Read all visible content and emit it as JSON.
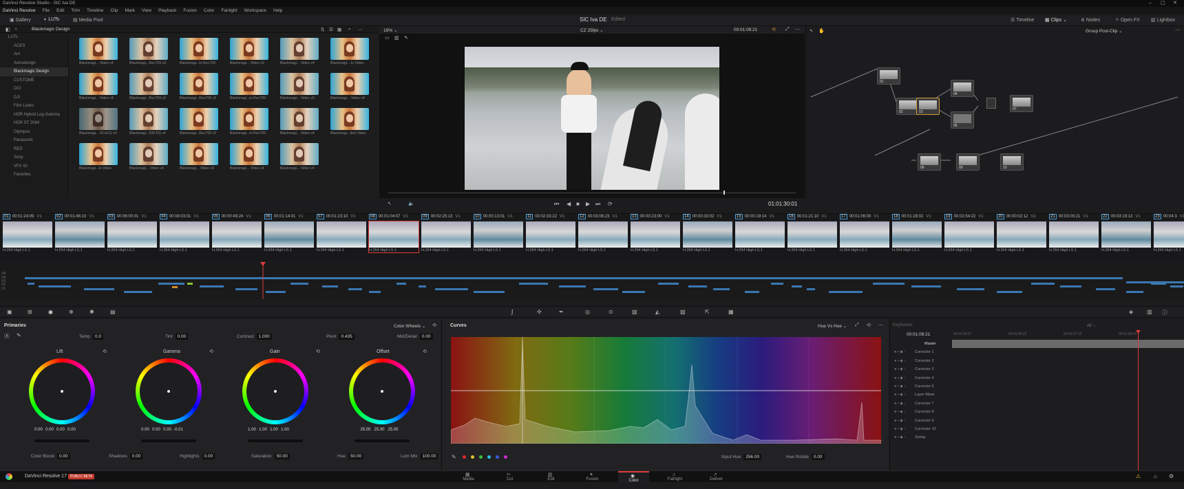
{
  "window": {
    "title": "DaVinci Resolve Studio - SIC Iva DE"
  },
  "menu": [
    "DaVinci Resolve",
    "File",
    "Edit",
    "Trim",
    "Timeline",
    "Clip",
    "Mark",
    "View",
    "Playback",
    "Fusion",
    "Color",
    "Fairlight",
    "Workspace",
    "Help"
  ],
  "toolbar": {
    "gallery": "Gallery",
    "luts": "LUTs",
    "media_pool": "Media Pool",
    "project_title": "SIC Iva DE",
    "edited": "Edited",
    "timeline": "Timeline",
    "clips": "Clips",
    "nodes": "Nodes",
    "openfx": "Open FX",
    "lightbox": "Lightbox"
  },
  "lut_browser": {
    "path": "Blackmagic Design",
    "tree": [
      "LUTs",
      "ACES",
      "Arri",
      "Astrodesign",
      "Blackmagic Design",
      "CUSTOME",
      "DCI",
      "DJI",
      "Film Looks",
      "HDR Hybrid Log-Gamma",
      "HDR ST 2084",
      "Olympus",
      "Panasonic",
      "RED",
      "Sony",
      "VFX IO",
      "Favorites"
    ],
    "items": [
      "Blackmagi... Video v4",
      "Blackmagi...Rec709 v3",
      "Blackmagi...to Rec709",
      "Blackmagi... Video v3",
      "Blackmagi... Video v4",
      "Blackmagi... to Video",
      "Blackmagi... Video v4",
      "Blackmagi...Rec709 v2",
      "Blackmagi...Rec709 v3",
      "Blackmagi...to Rec709",
      "Blackmagi... Video v5",
      "Blackmagi... Video v4",
      "Blackmagi... 20 HLG v4",
      "Blackmagi...028 PQ v4",
      "Blackmagi...Rec709 v2",
      "Blackmagi...to Rec709",
      "Blackmagi... Video v4",
      "Blackmagi...ded Video",
      "Blackmagi...to Video",
      "Blackmagi... Video v4",
      "Blackmagi... Video v4",
      "Blackmagi... Video v4",
      "Blackmagi... Video v4"
    ]
  },
  "viewer": {
    "zoom": "19%",
    "clip": "CZ 25fps",
    "timecode": "00:01:09:21",
    "position": "01:01:30:01"
  },
  "node_editor": {
    "mode": "Group Post-Clip",
    "nodes": [
      "01",
      "02",
      "03",
      "04",
      "05",
      "06",
      "07",
      "08",
      "09",
      "10"
    ]
  },
  "clips": [
    {
      "n": "01",
      "tc": "00:01:24:09",
      "track": "V1"
    },
    {
      "n": "02",
      "tc": "00:01:46:10",
      "track": "V1"
    },
    {
      "n": "03",
      "tc": "00:06:00:01",
      "track": "V1"
    },
    {
      "n": "04",
      "tc": "00:08:03:01",
      "track": "V1"
    },
    {
      "n": "05",
      "tc": "00:00:49:24",
      "track": "V1"
    },
    {
      "n": "06",
      "tc": "00:01:14:01",
      "track": "V1"
    },
    {
      "n": "07",
      "tc": "00:01:23:10",
      "track": "V1"
    },
    {
      "n": "08",
      "tc": "00:01:04:07",
      "track": "V1"
    },
    {
      "n": "09",
      "tc": "00:02:25:13",
      "track": "V1"
    },
    {
      "n": "10",
      "tc": "00:00:13:01",
      "track": "V1"
    },
    {
      "n": "11",
      "tc": "00:02:33:22",
      "track": "V1"
    },
    {
      "n": "12",
      "tc": "00:03:06:23",
      "track": "V1"
    },
    {
      "n": "13",
      "tc": "00:00:23:00",
      "track": "V1"
    },
    {
      "n": "14",
      "tc": "00:00:33:02",
      "track": "V1"
    },
    {
      "n": "15",
      "tc": "00:00:19:14",
      "track": "V1"
    },
    {
      "n": "16",
      "tc": "00:01:21:10",
      "track": "V1"
    },
    {
      "n": "17",
      "tc": "00:01:06:00",
      "track": "V1"
    },
    {
      "n": "18",
      "tc": "00:01:28:02",
      "track": "V1"
    },
    {
      "n": "19",
      "tc": "00:02:54:22",
      "track": "V1"
    },
    {
      "n": "20",
      "tc": "00:00:02:12",
      "track": "V2"
    },
    {
      "n": "21",
      "tc": "00:03:00:21",
      "track": "V1"
    },
    {
      "n": "22",
      "tc": "00:03:19:13",
      "track": "V1"
    },
    {
      "n": "23",
      "tc": "00:04:3",
      "track": "V1"
    }
  ],
  "clip_codec": "H.264 High L5.1",
  "primaries": {
    "title": "Primaries",
    "mode": "Color Wheels",
    "temp_label": "Temp",
    "temp": "0.0",
    "tint_label": "Tint",
    "tint": "0.00",
    "contrast_label": "Contrast",
    "contrast": "1.000",
    "pivot_label": "Pivot",
    "pivot": "0.435",
    "middetail_label": "Mid/Detail",
    "middetail": "0.00",
    "wheels": [
      {
        "name": "Lift",
        "vals": [
          "0.00",
          "0.00",
          "0.00",
          "0.00"
        ]
      },
      {
        "name": "Gamma",
        "vals": [
          "0.00",
          "0.00",
          "0.00",
          "-0.01"
        ]
      },
      {
        "name": "Gain",
        "vals": [
          "1.00",
          "1.00",
          "1.00",
          "1.00"
        ]
      },
      {
        "name": "Offset",
        "vals": [
          "25.00",
          "25.00",
          "25.00"
        ]
      }
    ],
    "colorboost_label": "Color Boost",
    "colorboost": "0.00",
    "shadows_label": "Shadows",
    "shadows": "0.00",
    "highlights_label": "Highlights",
    "highlights": "0.00",
    "saturation_label": "Saturation",
    "saturation": "50.00",
    "hue_label": "Hue",
    "hue": "50.00",
    "lummix_label": "Lum Mix",
    "lummix": "100.00"
  },
  "curves": {
    "title": "Curves",
    "mode": "Hue Vs Hue",
    "input_hue_label": "Input Hue",
    "input_hue": "256.00",
    "hue_rotate_label": "Hue Rotate",
    "hue_rotate": "0.00"
  },
  "keyframes": {
    "title": "Keyframes",
    "filter": "All",
    "timecode": "00:01:09:21",
    "ticks": [
      "00:01:04:07",
      "00:01:05:22",
      "00:01:07:12",
      "00:01:09:07"
    ],
    "rows": [
      "Master",
      "Corrector 1",
      "Corrector 2",
      "Corrector 3",
      "Corrector 4",
      "Corrector 5",
      "Layer Mixer",
      "Corrector 7",
      "Corrector 8",
      "Corrector 9",
      "Corrector 10",
      "Sizing"
    ]
  },
  "bottom": {
    "app": "DaVinci Resolve 17",
    "badge": "PUBLIC BETA",
    "pages": [
      "Media",
      "Cut",
      "Edit",
      "Fusion",
      "Color",
      "Fairlight",
      "Deliver"
    ]
  },
  "colors": {
    "accent": "#e03b3b",
    "node_border": "#555555"
  }
}
